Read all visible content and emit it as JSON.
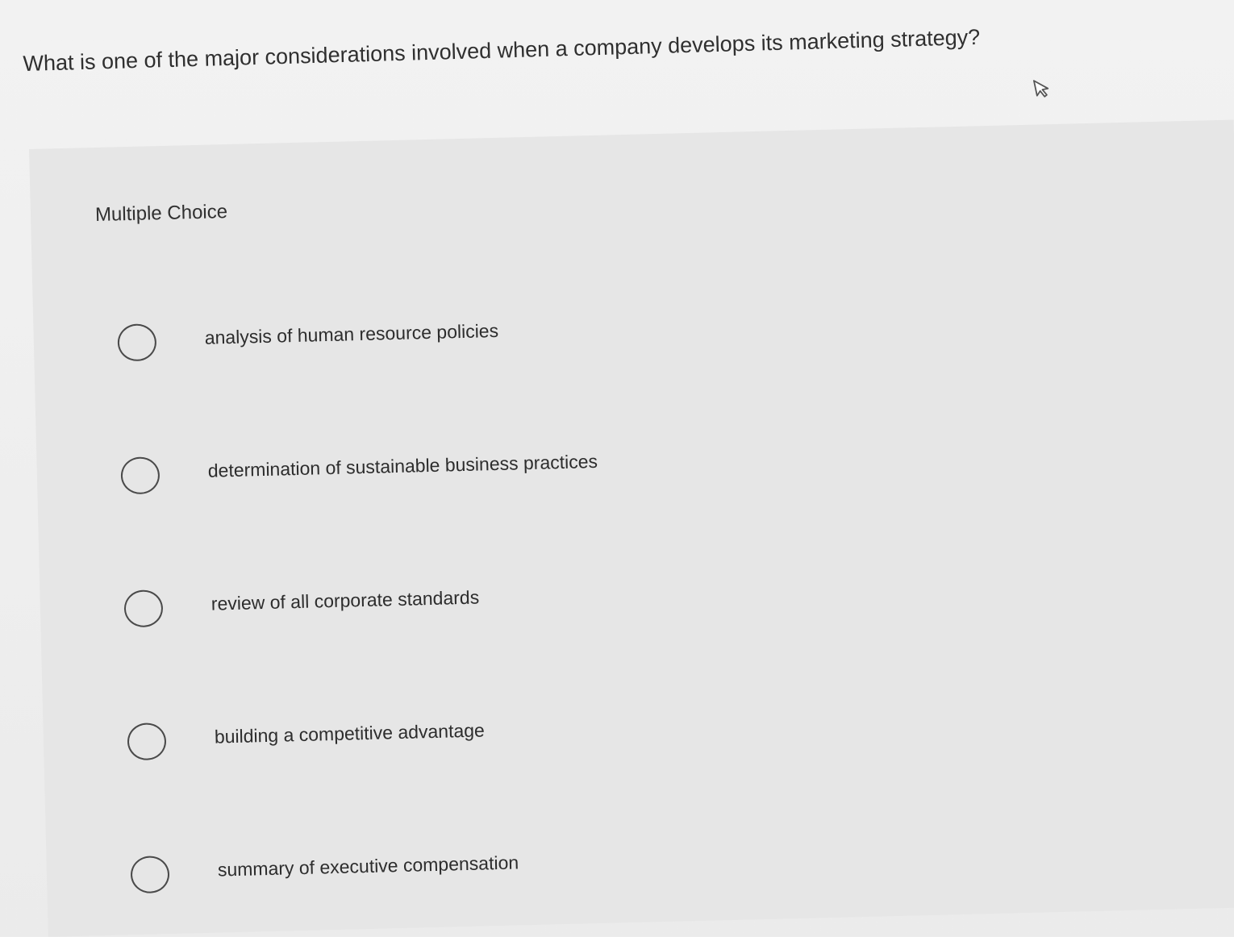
{
  "question": {
    "text": "What is one of the major considerations involved when a company develops its marketing strategy?"
  },
  "panel": {
    "title": "Multiple Choice"
  },
  "options": [
    {
      "label": "analysis of human resource policies"
    },
    {
      "label": "determination of sustainable business practices"
    },
    {
      "label": "review of all corporate standards"
    },
    {
      "label": "building a competitive advantage"
    },
    {
      "label": "summary of executive compensation"
    }
  ],
  "icons": {
    "cursor": "mouse-pointer-icon",
    "radio": "radio-unselected-icon"
  }
}
